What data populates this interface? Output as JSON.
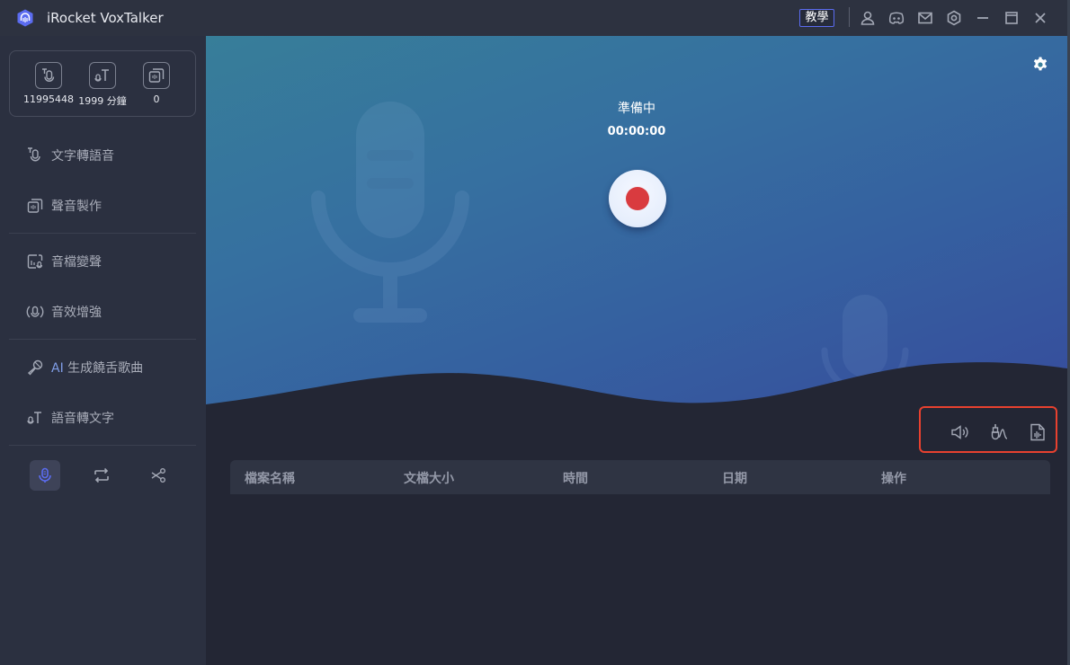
{
  "app": {
    "title": "iRocket VoxTalker",
    "logo_icon": "headphones-logo-icon"
  },
  "titlebar": {
    "tutorial_label": "教學",
    "icons": [
      "user-icon",
      "discord-icon",
      "mail-icon",
      "settings-hex-icon",
      "minimize-icon",
      "maximize-icon",
      "close-icon"
    ]
  },
  "stats": [
    {
      "icon": "text-to-speech-icon",
      "value": "11995448"
    },
    {
      "icon": "speech-to-text-icon",
      "value": "1999 分鐘"
    },
    {
      "icon": "voice-clone-icon",
      "value": "0"
    }
  ],
  "sidebar": {
    "items": [
      {
        "label": "文字轉語音",
        "icon": "text-to-speech-icon"
      },
      {
        "label": "聲音製作",
        "icon": "voice-clone-icon"
      },
      {
        "label": "音檔變聲",
        "icon": "audio-voice-change-icon"
      },
      {
        "label": "音效增強",
        "icon": "audio-enhance-icon"
      },
      {
        "label_prefix": "AI",
        "label": " 生成饒舌歌曲",
        "icon": "microphone-karaoke-icon"
      },
      {
        "label": "語音轉文字",
        "icon": "speech-to-text-icon"
      }
    ],
    "bottom_tabs": [
      {
        "name": "record",
        "icon": "microphone-icon",
        "active": true
      },
      {
        "name": "convert",
        "icon": "repeat-icon",
        "active": false
      },
      {
        "name": "cut",
        "icon": "scissors-icon",
        "active": false
      }
    ]
  },
  "recorder": {
    "status": "準備中",
    "timer": "00:00:00",
    "record_color": "#d93b3f"
  },
  "tools": {
    "icons": [
      "speaker-icon",
      "audio-jack-icon",
      "audio-file-icon"
    ],
    "highlight_color": "#e8412f"
  },
  "table": {
    "columns": [
      "檔案名稱",
      "文檔大小",
      "時間",
      "日期",
      "操作"
    ],
    "rows": []
  },
  "colors": {
    "accent": "#5b6cf0",
    "sidebar_bg": "#2b3040",
    "main_bg": "#232634",
    "titlebar_bg": "#2d3240"
  }
}
